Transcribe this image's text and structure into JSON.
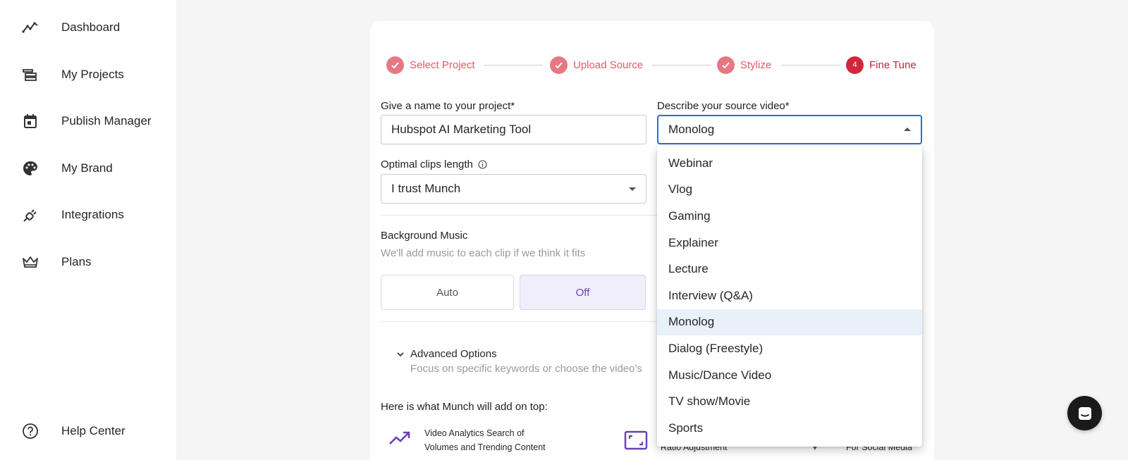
{
  "sidebar": {
    "items": [
      {
        "label": "Dashboard",
        "icon": "trending-chart-icon"
      },
      {
        "label": "My Projects",
        "icon": "projects-stack-icon"
      },
      {
        "label": "Publish Manager",
        "icon": "calendar-icon"
      },
      {
        "label": "My Brand",
        "icon": "palette-icon"
      },
      {
        "label": "Integrations",
        "icon": "plug-icon"
      },
      {
        "label": "Plans",
        "icon": "crown-icon"
      }
    ],
    "help": {
      "label": "Help Center",
      "icon": "help-circle-icon"
    }
  },
  "stepper": {
    "steps": [
      {
        "label": "Select Project",
        "state": "done"
      },
      {
        "label": "Upload Source",
        "state": "done"
      },
      {
        "label": "Stylize",
        "state": "done"
      },
      {
        "label": "Fine Tune",
        "state": "active",
        "number": "4"
      }
    ]
  },
  "form": {
    "project_name_label": "Give a name to your project*",
    "project_name_value": "Hubspot AI Marketing Tool",
    "source_video_label": "Describe your source video*",
    "source_video_value": "Monolog",
    "clips_length_label": "Optimal clips length",
    "clips_length_value": "I trust Munch",
    "bg_music_title": "Background Music",
    "bg_music_sub": "We'll add music to each clip if we think it fits",
    "music_options": {
      "auto": "Auto",
      "off": "Off"
    },
    "advanced_title": "Advanced Options",
    "advanced_sub": "Focus on specific keywords or choose the video's",
    "extras_title": "Here is what Munch will add on top:",
    "feature_1_line1": "Video Analytics Search of",
    "feature_1_line2": "Volumes and Trending Content",
    "feature_2_partial": "Ratio Adjustment",
    "feature_3_partial": "For Social Media"
  },
  "dropdown": {
    "options": [
      "Webinar",
      "Vlog",
      "Gaming",
      "Explainer",
      "Lecture",
      "Interview (Q&A)",
      "Monolog",
      "Dialog (Freestyle)",
      "Music/Dance Video",
      "TV show/Movie",
      "Sports"
    ],
    "selected": "Monolog"
  },
  "colors": {
    "step_done": "#e57882",
    "step_active": "#d0283b",
    "accent_purple": "#6b3fb8",
    "focus_blue": "#1976d2"
  }
}
